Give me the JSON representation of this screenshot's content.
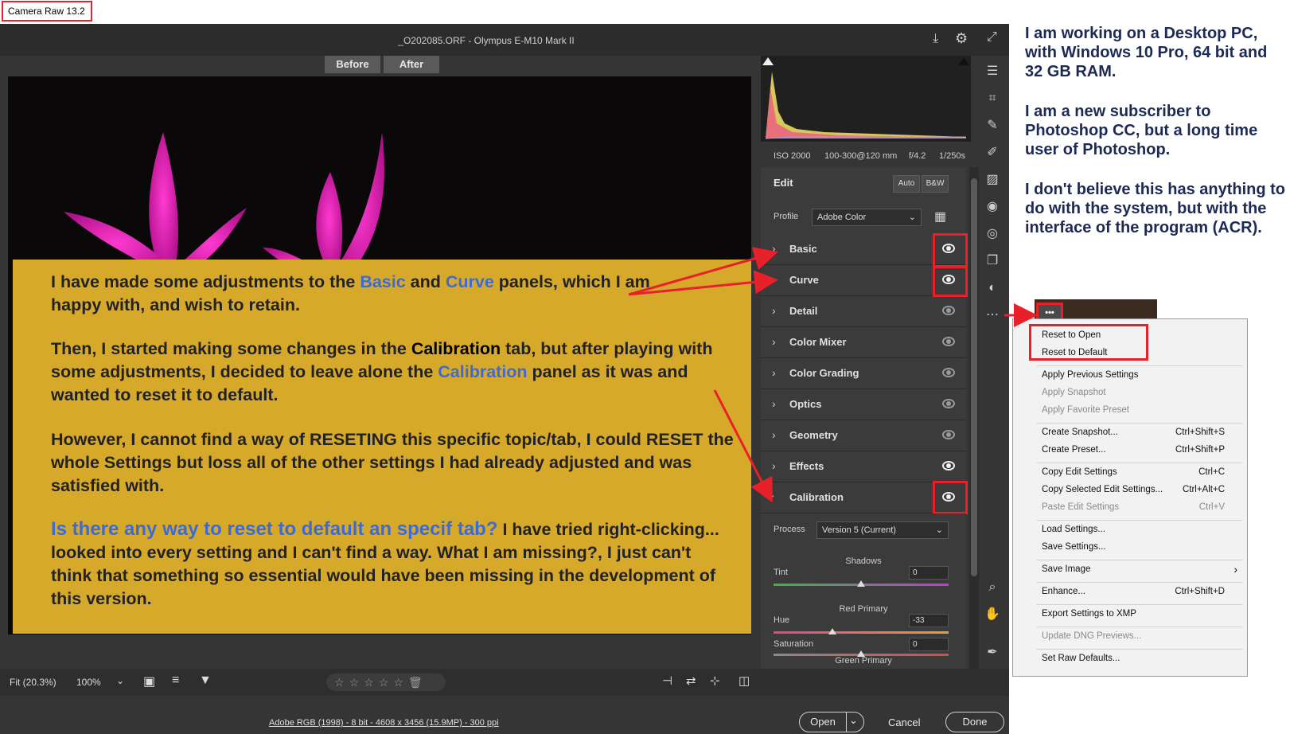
{
  "app": {
    "title": "Camera Raw 13.2"
  },
  "header": {
    "file_title": "_O202085.ORF  -  Olympus E-M10 Mark II",
    "before": "Before",
    "after": "After"
  },
  "annotation": {
    "p1a": "I have made some adjustments to the ",
    "p1b": "Basic",
    "p1c": " and ",
    "p1d": "Curve",
    "p1e": " panels, which I am happy with, and wish to retain.",
    "p2a": "Then, I started making some changes in the ",
    "p2b": "Calibration",
    "p2c": " tab, but after playing with some adjustments, I decided to leave alone the ",
    "p2d": "Calibration",
    "p2e": " panel as it was and wanted to reset it to default.",
    "p3": "However, I cannot find a way of RESETING this specific topic/tab, I could RESET the whole Settings but loss all of the other settings I had already adjusted and was satisfied with.",
    "p4a": "Is there any way to reset to default an specif tab?",
    "p4b": " I have tried right-clicking... looked into every setting and I can't find a way. What I am missing?, I just can't think that something so essential would have been missing in the development of this version."
  },
  "exif": {
    "iso": "ISO 2000",
    "lens": "100-300@120 mm",
    "aperture": "f/4.2",
    "shutter": "1/250s"
  },
  "edit": {
    "title": "Edit",
    "auto": "Auto",
    "bw": "B&W",
    "profile_label": "Profile",
    "profile_value": "Adobe Color"
  },
  "panels": [
    {
      "label": "Basic",
      "visible": true
    },
    {
      "label": "Curve",
      "visible": true
    },
    {
      "label": "Detail",
      "visible": false
    },
    {
      "label": "Color Mixer",
      "visible": false
    },
    {
      "label": "Color Grading",
      "visible": false
    },
    {
      "label": "Optics",
      "visible": false
    },
    {
      "label": "Geometry",
      "visible": false
    },
    {
      "label": "Effects",
      "visible": true
    },
    {
      "label": "Calibration",
      "visible": true
    }
  ],
  "calibration": {
    "process_label": "Process",
    "process_value": "Version 5 (Current)",
    "shadows": "Shadows",
    "tint_label": "Tint",
    "tint_value": "0",
    "red_primary": "Red Primary",
    "hue_label": "Hue",
    "hue_value": "-33",
    "sat_label": "Saturation",
    "sat_value": "0",
    "green_primary": "Green Primary"
  },
  "bottom": {
    "fit": "Fit (20.3%)",
    "zoom": "100%"
  },
  "footer": {
    "info": "Adobe RGB (1998) - 8 bit - 4608 x 3456 (15.9MP) - 300 ppi",
    "open": "Open",
    "cancel": "Cancel",
    "done": "Done"
  },
  "notes": {
    "n1": "I am working on a Desktop PC, with Windows 10 Pro, 64 bit and 32 GB RAM.",
    "n2": "I am a new subscriber to Photoshop CC, but a long time user of Photoshop.",
    "n3": "I don't believe this has anything to do with the system, but with the interface of the program (ACR)."
  },
  "menu": {
    "dots": "•••",
    "items": [
      {
        "label": "Reset to Open",
        "shortcut": ""
      },
      {
        "label": "Reset to Default",
        "shortcut": ""
      },
      {
        "label": "Apply Previous Settings",
        "shortcut": ""
      },
      {
        "label": "Apply Snapshot",
        "shortcut": ""
      },
      {
        "label": "Apply Favorite Preset",
        "shortcut": ""
      },
      {
        "label": "Create Snapshot...",
        "shortcut": "Ctrl+Shift+S"
      },
      {
        "label": "Create Preset...",
        "shortcut": "Ctrl+Shift+P"
      },
      {
        "label": "Copy Edit Settings",
        "shortcut": "Ctrl+C"
      },
      {
        "label": "Copy Selected Edit Settings...",
        "shortcut": "Ctrl+Alt+C"
      },
      {
        "label": "Paste Edit Settings",
        "shortcut": "Ctrl+V"
      },
      {
        "label": "Load Settings...",
        "shortcut": ""
      },
      {
        "label": "Save Settings...",
        "shortcut": ""
      },
      {
        "label": "Save Image",
        "shortcut": "›"
      },
      {
        "label": "Enhance...",
        "shortcut": "Ctrl+Shift+D"
      },
      {
        "label": "Export Settings to XMP",
        "shortcut": ""
      },
      {
        "label": "Update DNG Previews...",
        "shortcut": ""
      },
      {
        "label": "Set Raw Defaults...",
        "shortcut": ""
      }
    ]
  },
  "colors": {
    "accent_red": "#e8202a",
    "overlay": "#d7a92a",
    "highlight_blue": "#3c6bd6"
  }
}
